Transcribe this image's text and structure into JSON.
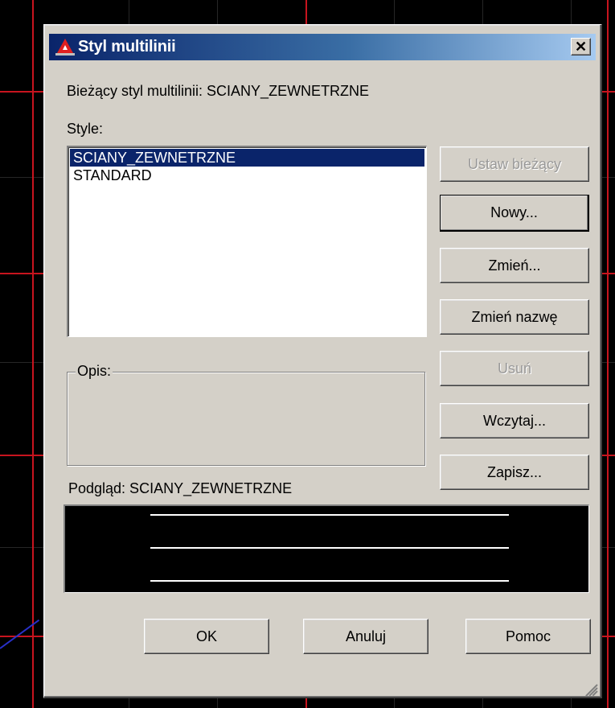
{
  "dialog": {
    "title": "Styl multilinii",
    "current_style_label": "Bieżący styl multilinii: SCIANY_ZEWNETRZNE",
    "styles_label": "Style:",
    "styles": [
      {
        "label": "SCIANY_ZEWNETRZNE",
        "selected": true
      },
      {
        "label": "STANDARD",
        "selected": false
      }
    ],
    "description_label": "Opis:",
    "preview_label": "Podgląd: SCIANY_ZEWNETRZNE",
    "buttons": {
      "set_current": "Ustaw bieżący",
      "new": "Nowy...",
      "modify": "Zmień...",
      "rename": "Zmień nazwę",
      "delete": "Usuń",
      "load": "Wczytaj...",
      "save": "Zapisz...",
      "ok": "OK",
      "cancel": "Anuluj",
      "help": "Pomoc"
    },
    "close_glyph": "✕"
  },
  "colors": {
    "dialog_bg": "#d4d0c8",
    "title_gradient_start": "#0a246a",
    "title_gradient_end": "#a6caf0",
    "selection": "#0a246a",
    "cad_background": "#000000",
    "cad_axis": "#c8141e"
  },
  "icons": [
    "autocad-app-icon",
    "close-icon",
    "resize-grip-icon"
  ]
}
